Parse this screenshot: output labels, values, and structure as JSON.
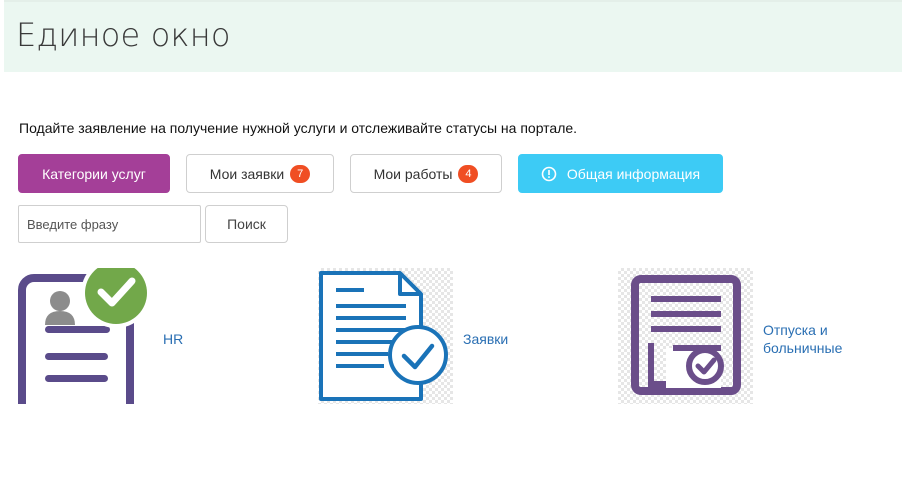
{
  "header": {
    "title": "Единое окно"
  },
  "intro": {
    "text": "Подайте заявление на получение нужной услуги и отслеживайте статусы на портале."
  },
  "toolbar": {
    "categories_label": "Категории услуг",
    "my_requests_label": "Мои заявки",
    "my_requests_count": "7",
    "my_works_label": "Мои работы",
    "my_works_count": "4",
    "general_info_label": "Общая информация"
  },
  "search": {
    "placeholder": "Введите фразу",
    "button_label": "Поиск"
  },
  "tiles": [
    {
      "label": "HR",
      "icon": "hr-profile-check-icon"
    },
    {
      "label": "Заявки",
      "icon": "document-check-icon"
    },
    {
      "label_line1": "Отпуска и",
      "label_line2": "больничные",
      "icon": "form-check-icon"
    }
  ],
  "colors": {
    "header_bg": "#ebf7f1",
    "primary": "#a43f98",
    "info": "#3dcbf5",
    "badge": "#f04e23",
    "link": "#2a6fb3",
    "hr_icon_purple": "#5a4b8a",
    "hr_check_green": "#72a84a",
    "doc_icon_blue": "#1a73b8",
    "form_icon_purple": "#6b4e8a"
  }
}
